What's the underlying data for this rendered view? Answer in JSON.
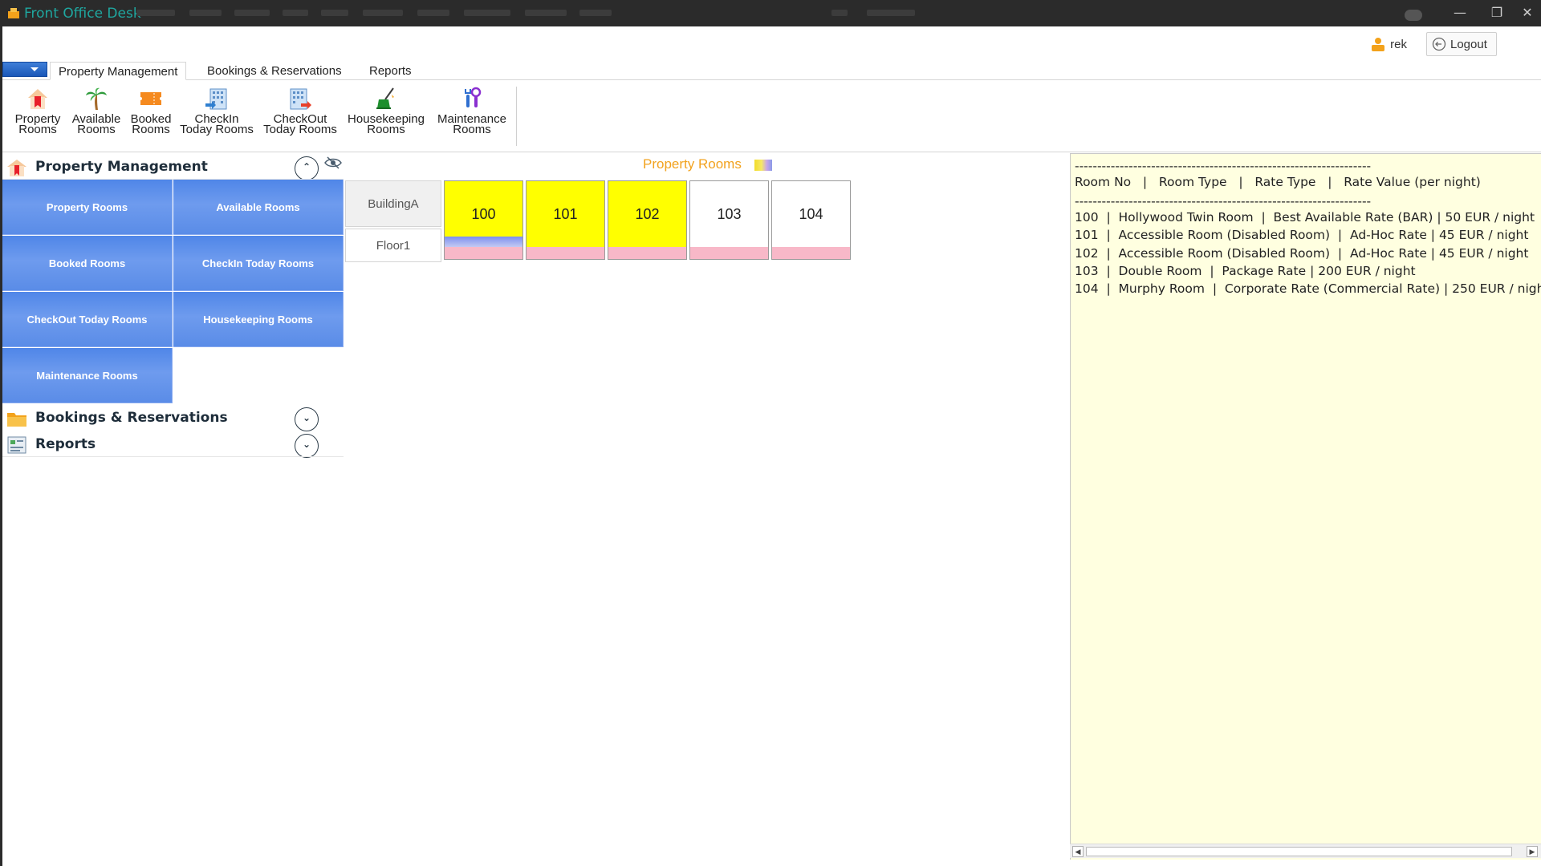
{
  "window": {
    "title": "Front Office Desk",
    "minimize_glyph": "—",
    "restore_glyph": "❐",
    "close_glyph": "✕"
  },
  "header": {
    "username": "rek",
    "logout_label": "Logout"
  },
  "ribbon": {
    "tabs": [
      {
        "label": "Property Management",
        "active": true
      },
      {
        "label": "Bookings & Reservations",
        "active": false
      },
      {
        "label": "Reports",
        "active": false
      }
    ],
    "items": [
      {
        "line1": "Property",
        "line2": "Rooms",
        "icon": "property-rooms-icon"
      },
      {
        "line1": "Available",
        "line2": "Rooms",
        "icon": "palm-tree-icon"
      },
      {
        "line1": "Booked",
        "line2": "Rooms",
        "icon": "ticket-icon"
      },
      {
        "line1": "CheckIn",
        "line2": "Today Rooms",
        "icon": "checkin-building-icon"
      },
      {
        "line1": "CheckOut",
        "line2": "Today Rooms",
        "icon": "checkout-building-icon"
      },
      {
        "line1": "Housekeeping",
        "line2": "Rooms",
        "icon": "broom-icon"
      },
      {
        "line1": "Maintenance",
        "line2": "Rooms",
        "icon": "tools-icon"
      }
    ]
  },
  "sidebar": {
    "sections": [
      {
        "title": "Property Management",
        "toggle": "⌃",
        "expanded": true
      },
      {
        "title": "Bookings & Reservations",
        "toggle": "⌄",
        "expanded": false
      },
      {
        "title": "Reports",
        "toggle": "⌄",
        "expanded": false
      }
    ],
    "tiles": [
      "Property Rooms",
      "Available Rooms",
      "Booked Rooms",
      "CheckIn Today Rooms",
      "CheckOut Today Rooms",
      "Housekeeping Rooms",
      "Maintenance Rooms"
    ]
  },
  "rooms_view": {
    "title": "Property Rooms",
    "building": "BuildingA",
    "floor": "Floor1",
    "rooms": [
      {
        "number": "100",
        "color": "#ffff00",
        "stripe": true
      },
      {
        "number": "101",
        "color": "#ffff00",
        "stripe": false
      },
      {
        "number": "102",
        "color": "#ffff00",
        "stripe": false
      },
      {
        "number": "103",
        "color": "#ffffff",
        "stripe": false
      },
      {
        "number": "104",
        "color": "#ffffff",
        "stripe": false
      }
    ]
  },
  "info_panel": {
    "separator": "------------------------------------------------------------------",
    "header": "Room No   |   Room Type   |   Rate Type   |   Rate Value (per night)",
    "lines": [
      "100  |  Hollywood Twin Room  |  Best Available Rate (BAR) | 50 EUR / night",
      "101  |  Accessible Room (Disabled Room)  |  Ad-Hoc Rate | 45 EUR / night",
      "102  |  Accessible Room (Disabled Room)  |  Ad-Hoc Rate | 45 EUR / night",
      "103  |  Double Room  |  Package Rate | 200 EUR / night",
      "104  |  Murphy Room  |  Corporate Rate (Commercial Rate) | 250 EUR / nigh"
    ],
    "scroll_left": "◀",
    "scroll_right": "▶"
  }
}
